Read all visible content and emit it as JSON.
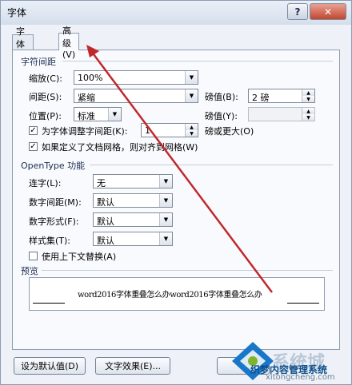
{
  "window": {
    "title": "字体",
    "help_label": "?",
    "close_label": "✕"
  },
  "tabs": [
    {
      "label": "字体(N)",
      "active": false
    },
    {
      "label": "高级(V)",
      "active": true
    }
  ],
  "spacing_section": {
    "heading": "字符间距",
    "scale_label": "缩放(C):",
    "scale_value": "100%",
    "spacing_label": "间距(S):",
    "spacing_value": "紧缩",
    "spacing_by_label": "磅值(B):",
    "spacing_by_value": "2 磅",
    "position_label": "位置(P):",
    "position_value": "标准",
    "position_by_label": "磅值(Y):",
    "position_by_value": "",
    "kerning": {
      "label": "为字体调整字间距(K):",
      "checked": true,
      "value": "1",
      "suffix": "磅或更大(O)"
    },
    "grid": {
      "label": "如果定义了文档网格，则对齐到网格(W)",
      "checked": true
    }
  },
  "opentype_section": {
    "heading": "OpenType 功能",
    "ligatures_label": "连字(L):",
    "ligatures_value": "无",
    "num_spacing_label": "数字间距(M):",
    "num_spacing_value": "默认",
    "num_forms_label": "数字形式(F):",
    "num_forms_value": "默认",
    "stylistic_label": "样式集(T):",
    "stylistic_value": "默认",
    "contextual": {
      "label": "使用上下文替换(A)",
      "checked": false
    }
  },
  "preview": {
    "heading": "预览",
    "text": "word2016字体重叠怎么办word2016字体重叠怎么办"
  },
  "buttons": {
    "set_default": "设为默认值(D)",
    "text_effects": "文字效果(E)..."
  },
  "watermark": {
    "logo_text": "系统城",
    "site_cn": "织梦内容管理系统",
    "site_en": "xitongcheng.com"
  },
  "colors": {
    "annotation_arrow": "#c0282d",
    "accent": "#0d4f8a"
  }
}
